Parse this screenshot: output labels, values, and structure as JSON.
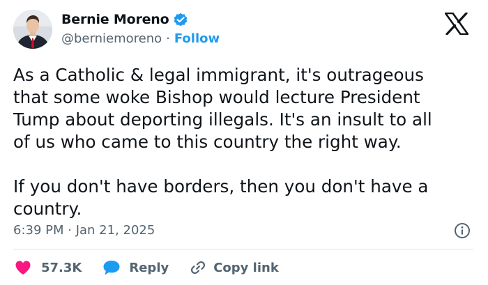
{
  "author": {
    "name": "Bernie Moreno",
    "handle": "@berniemoreno",
    "separator": "·",
    "follow_label": "Follow",
    "verified": true
  },
  "tweet": {
    "text": "As a Catholic & legal immigrant, it's outrageous\nthat some woke Bishop would lecture President\nTump about deporting illegals. It's an insult to all\nof us who came to this country the right way.\n\nIf you don't have borders, then you don't have a\ncountry.",
    "timestamp": "6:39 PM · Jan 21, 2025"
  },
  "actions": {
    "like_count": "57.3K",
    "reply_label": "Reply",
    "copy_link_label": "Copy link"
  },
  "icons": {
    "logo": "x-logo-icon",
    "verified": "verified-badge-icon",
    "info": "info-icon",
    "like": "heart-icon",
    "reply": "speech-bubble-icon",
    "copy": "link-icon"
  },
  "colors": {
    "accent": "#1d9bf0",
    "like": "#f91880",
    "text": "#0f1419",
    "muted": "#536471",
    "divider": "#e1e6ea"
  }
}
